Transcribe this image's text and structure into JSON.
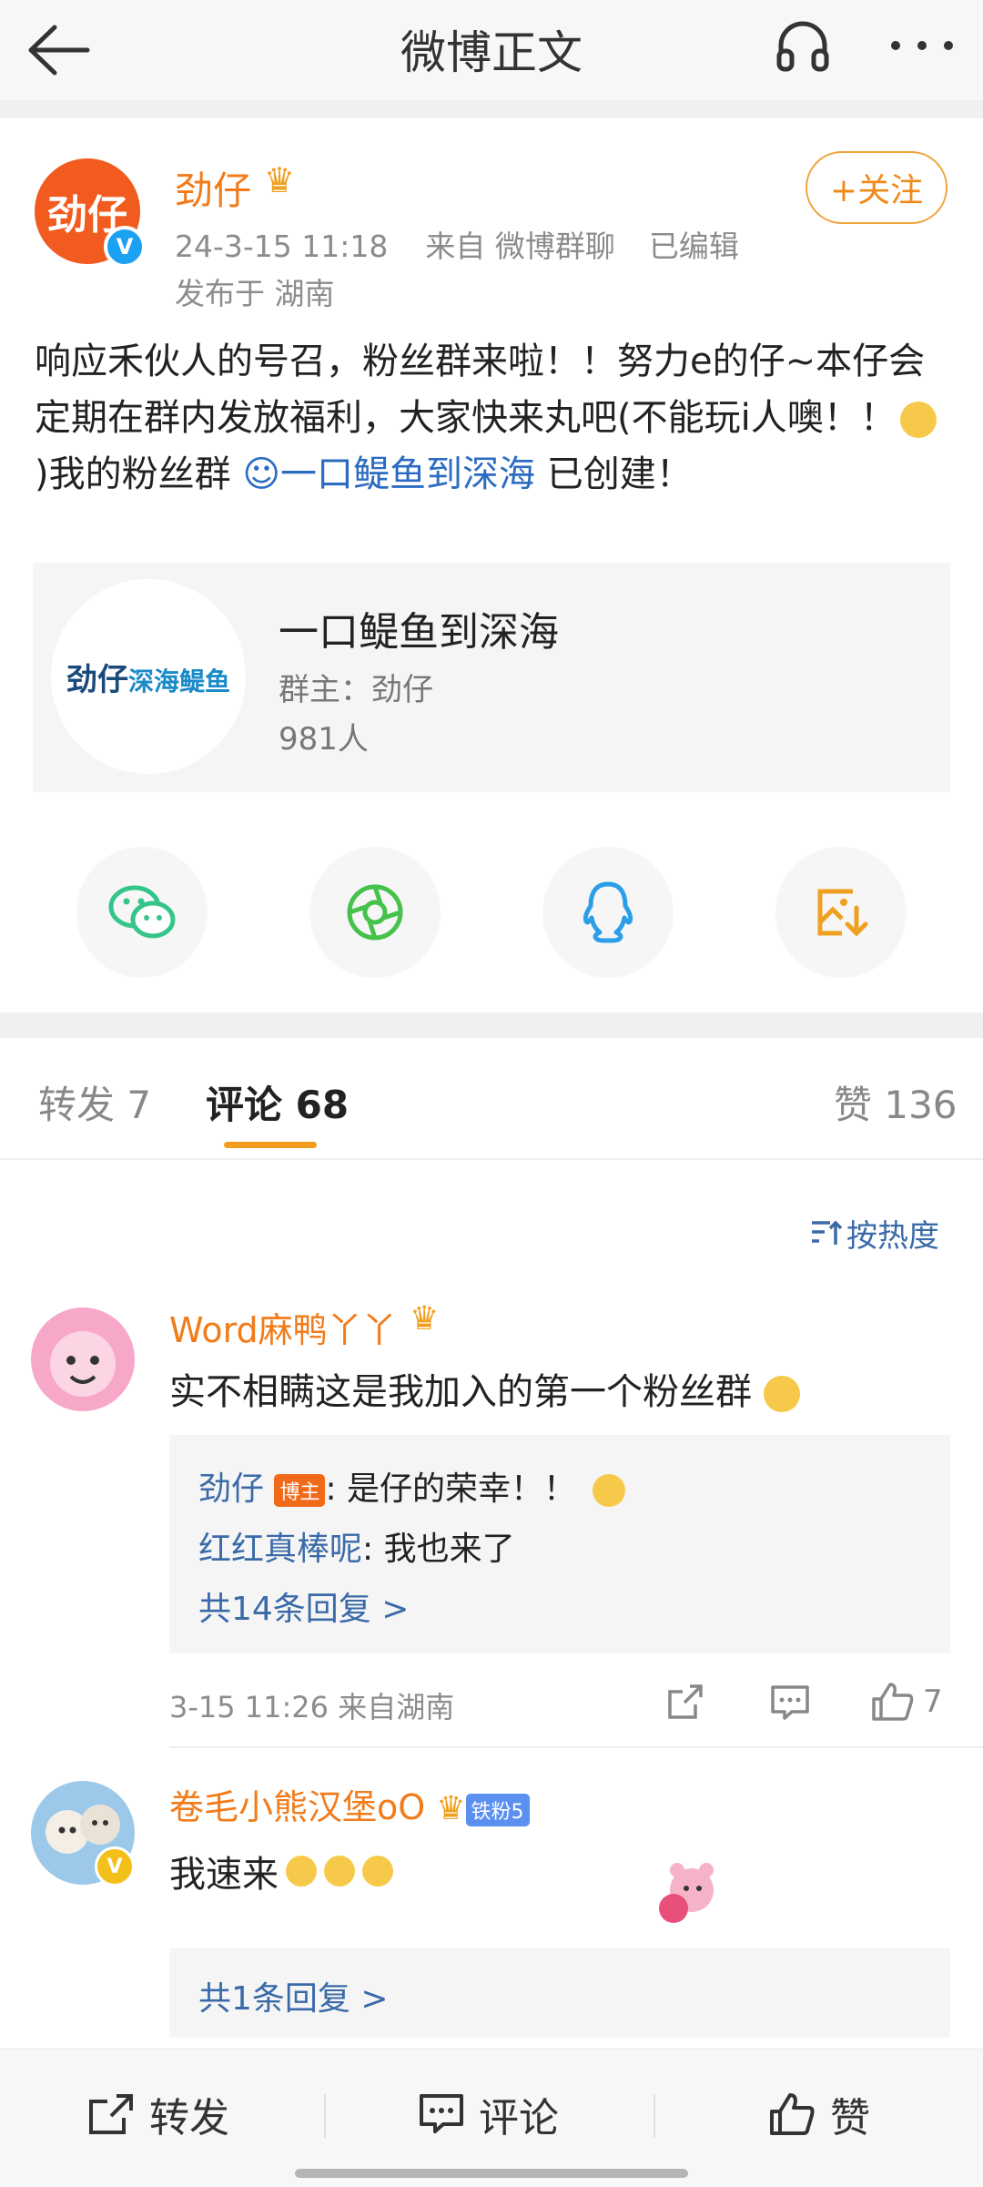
{
  "header": {
    "title": "微博正文"
  },
  "post": {
    "author": "劲仔",
    "avatar_text": "劲仔",
    "time": "24-3-15 11:18",
    "source": "来自 微博群聊",
    "edited": "已编辑",
    "location": "发布于 湖南",
    "follow_label": "+关注",
    "content_part1": "响应禾伙人的号召，粉丝群来啦！！努力e的仔~本仔会定期在群内发放福利，大家快来丸吧(不能玩i人噢！！",
    "content_part2": ")我的粉丝群 ",
    "group_link": "一口鳀鱼到深海",
    "content_part3": " 已创建！"
  },
  "group_card": {
    "logo_text": "劲仔",
    "logo_sub": "深海鳀鱼",
    "name": "一口鳀鱼到深海",
    "owner": "群主：劲仔",
    "members": "981人"
  },
  "share": [
    {
      "icon": "wechat-icon"
    },
    {
      "icon": "moments-icon"
    },
    {
      "icon": "qq-icon"
    },
    {
      "icon": "save-image-icon"
    }
  ],
  "tabs": {
    "repost": "转发 7",
    "comments": "评论 68",
    "likes": "赞 136"
  },
  "sort_label": "按热度",
  "comments": [
    {
      "user": "Word麻鸭丫丫",
      "text": "实不相瞒这是我加入的第一个粉丝群",
      "replies": [
        {
          "user": "劲仔",
          "badge": "博主",
          "text": ": 是仔的荣幸！！"
        },
        {
          "user": "红红真棒呢",
          "text": ": 我也来了"
        }
      ],
      "more_replies": "共14条回复 >",
      "meta": "3-15 11:26 来自湖南",
      "like_count": "7"
    },
    {
      "user": "卷毛小熊汉堡oO",
      "fan_badge": "铁粉5",
      "text": "我速来",
      "more_replies": "共1条回复 >"
    }
  ],
  "bottom_bar": {
    "repost": "转发",
    "comment": "评论",
    "like": "赞"
  },
  "colors": {
    "accent": "#f27b1a",
    "link": "#2b6cc2",
    "tab_underline": "#f29b1f"
  }
}
